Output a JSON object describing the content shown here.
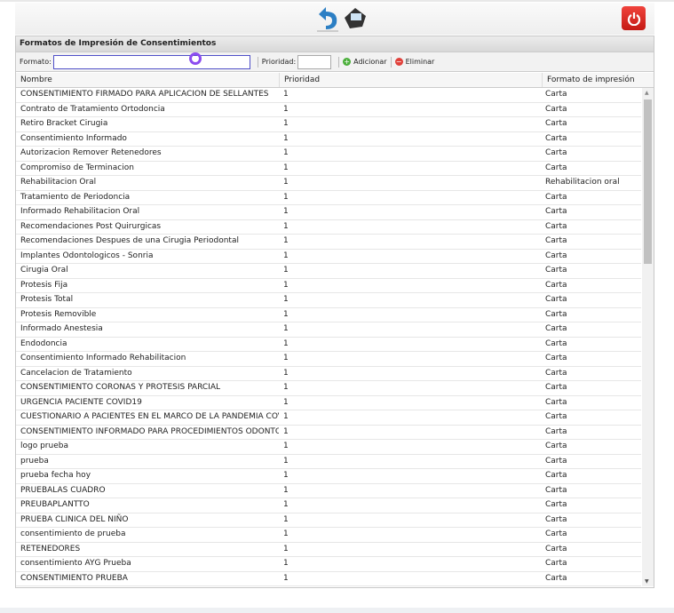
{
  "panel_title": "Formatos de Impresión de Consentimientos",
  "form": {
    "formato_label": "Formato:",
    "formato_value": "",
    "prioridad_label": "Prioridad:",
    "prioridad_value": "",
    "add_label": "Adicionar",
    "delete_label": "Eliminar"
  },
  "columns": [
    "Nombre",
    "Prioridad",
    "Formato de impresión"
  ],
  "rows": [
    [
      "CONSENTIMIENTO FIRMADO PARA APLICACION DE SELLANTES",
      "1",
      "Carta"
    ],
    [
      "Contrato de Tratamiento Ortodoncia",
      "1",
      "Carta"
    ],
    [
      "Retiro Bracket Cirugia",
      "1",
      "Carta"
    ],
    [
      "Consentimiento Informado",
      "1",
      "Carta"
    ],
    [
      "Autorizacion Remover Retenedores",
      "1",
      "Carta"
    ],
    [
      "Compromiso de Terminacion",
      "1",
      "Carta"
    ],
    [
      "Rehabilitacion Oral",
      "1",
      "Rehabilitacion oral"
    ],
    [
      "Tratamiento de Periodoncia",
      "1",
      "Carta"
    ],
    [
      "Informado Rehabilitacion Oral",
      "1",
      "Carta"
    ],
    [
      "Recomendaciones Post Quirurgicas",
      "1",
      "Carta"
    ],
    [
      "Recomendaciones Despues de una Cirugia Periodontal",
      "1",
      "Carta"
    ],
    [
      "Implantes Odontologicos - Sonria",
      "1",
      "Carta"
    ],
    [
      "Cirugia Oral",
      "1",
      "Carta"
    ],
    [
      "Protesis Fija",
      "1",
      "Carta"
    ],
    [
      "Protesis Total",
      "1",
      "Carta"
    ],
    [
      "Protesis Removible",
      "1",
      "Carta"
    ],
    [
      "Informado Anestesia",
      "1",
      "Carta"
    ],
    [
      "Endodoncia",
      "1",
      "Carta"
    ],
    [
      "Consentimiento Informado Rehabilitacion",
      "1",
      "Carta"
    ],
    [
      "Cancelacion de Tratamiento",
      "1",
      "Carta"
    ],
    [
      "CONSENTIMIENTO CORONAS Y PROTESIS PARCIAL",
      "1",
      "Carta"
    ],
    [
      "URGENCIA PACIENTE COVID19",
      "1",
      "Carta"
    ],
    [
      "CUESTIONARIO A PACIENTES EN EL MARCO DE LA PANDEMIA COVI...",
      "1",
      "Carta"
    ],
    [
      "CONSENTIMIENTO INFORMADO PARA PROCEDIMIENTOS ODONTOL...",
      "1",
      "Carta"
    ],
    [
      "logo prueba",
      "1",
      "Carta"
    ],
    [
      "prueba",
      "1",
      "Carta"
    ],
    [
      "prueba fecha hoy",
      "1",
      "Carta"
    ],
    [
      "PRUEBALAS CUADRO",
      "1",
      "Carta"
    ],
    [
      "PREUBAPLANTTO",
      "1",
      "Carta"
    ],
    [
      "PRUEBA CLINICA DEL NIÑO",
      "1",
      "Carta"
    ],
    [
      "consentimiento de prueba",
      "1",
      "Carta"
    ],
    [
      "RETENEDORES",
      "1",
      "Carta"
    ],
    [
      "consentimiento AYG Prueba",
      "1",
      "Carta"
    ],
    [
      "CONSENTIMIENTO PRUEBA",
      "1",
      "Carta"
    ]
  ]
}
